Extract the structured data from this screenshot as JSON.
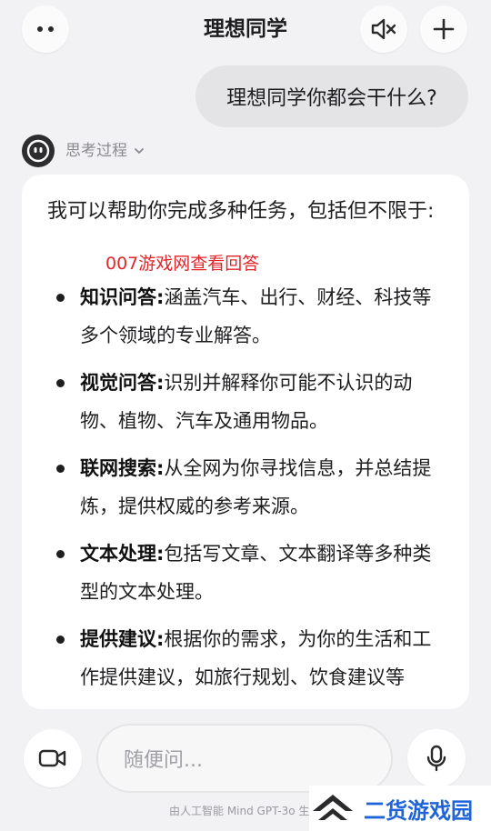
{
  "header": {
    "title": "理想同学",
    "menu_icon": "more-dots-icon",
    "mute_icon": "speaker-mute-icon",
    "add_icon": "plus-icon"
  },
  "conversation": {
    "user_message": "理想同学你都会干什么?",
    "thinking_label": "思考过程",
    "answer_intro": "我可以帮助你完成多种任务，包括但不限于:",
    "watermark_red": "007游戏网查看回答",
    "items": [
      {
        "title": "知识问答",
        "sep": ":",
        "text": "涵盖汽车、出行、财经、科技等多个领域的专业解答。"
      },
      {
        "title": "视觉问答",
        "sep": ":",
        "text": "识别并解释你可能不认识的动物、植物、汽车及通用物品。"
      },
      {
        "title": "联网搜索",
        "sep": ":",
        "text": "从全网为你寻找信息，并总结提炼，提供权威的参考来源。"
      },
      {
        "title": "文本处理",
        "sep": ":",
        "text": "包括写文章、文本翻译等多种类型的文本处理。"
      },
      {
        "title": "提供建议",
        "sep": ":",
        "text": "根据你的需求，为你的生活和工作提供建议，如旅行规划、饮食建议等"
      }
    ]
  },
  "input": {
    "placeholder": "随便问...",
    "camera_icon": "video-camera-icon",
    "mic_icon": "microphone-icon"
  },
  "footer": {
    "note": "由人工智能 Mind GPT-3o 生成",
    "brand": "二货游戏园"
  },
  "colors": {
    "background": "#f2f2f4",
    "card": "#ffffff",
    "user_bubble": "#e4e4e7",
    "watermark_red": "#e0262a",
    "brand_blue": "#1f63d9"
  }
}
